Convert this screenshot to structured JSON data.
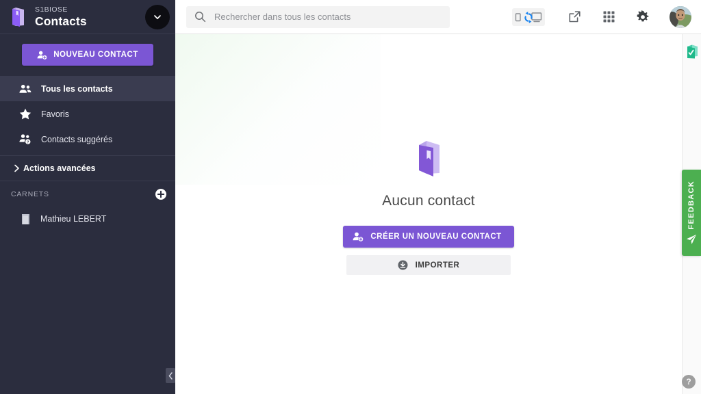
{
  "brand": {
    "sub": "S1BIOSE",
    "title": "Contacts",
    "logo_icon": "address-book-icon",
    "chevron_icon": "chevron-down-icon",
    "accent": "#7b56d4"
  },
  "sidebar": {
    "new_contact_label": "NOUVEAU CONTACT",
    "new_contact_icon": "person-add-icon",
    "items": [
      {
        "label": "Tous les contacts",
        "icon": "people-icon",
        "active": true
      },
      {
        "label": "Favoris",
        "icon": "star-icon",
        "active": false
      },
      {
        "label": "Contacts suggérés",
        "icon": "people-suggested-icon",
        "active": false
      }
    ],
    "advanced": {
      "label": "Actions avancées",
      "icon": "chevron-right-icon"
    },
    "section": {
      "label": "CARNETS",
      "add_icon": "plus-circle-icon"
    },
    "books": [
      {
        "label": "Mathieu LEBERT",
        "icon": "address-book-small-icon"
      }
    ],
    "collapse_icon": "chevron-left-icon",
    "background": "#2b2d3e"
  },
  "topbar": {
    "search": {
      "placeholder": "Rechercher dans tous les contacts",
      "value": "",
      "icon": "search-icon"
    },
    "icons": [
      {
        "name": "sync-devices-icon",
        "title": ""
      },
      {
        "name": "external-link-icon",
        "title": ""
      },
      {
        "name": "apps-grid-icon",
        "title": ""
      },
      {
        "name": "gear-icon",
        "title": ""
      }
    ],
    "avatar": "user-avatar"
  },
  "empty_state": {
    "illustration_icon": "address-book-illustration",
    "title": "Aucun contact",
    "primary_button": {
      "label": "CRÉER UN NOUVEAU CONTACT",
      "icon": "person-add-icon"
    },
    "secondary_button": {
      "label": "IMPORTER",
      "icon": "download-circle-icon"
    }
  },
  "right_rail": {
    "app_icon": "tasks-check-icon",
    "feedback_label": "FEEDBACK",
    "feedback_icon": "paper-plane-icon",
    "feedback_color": "#4caf50",
    "help_label": "?"
  }
}
